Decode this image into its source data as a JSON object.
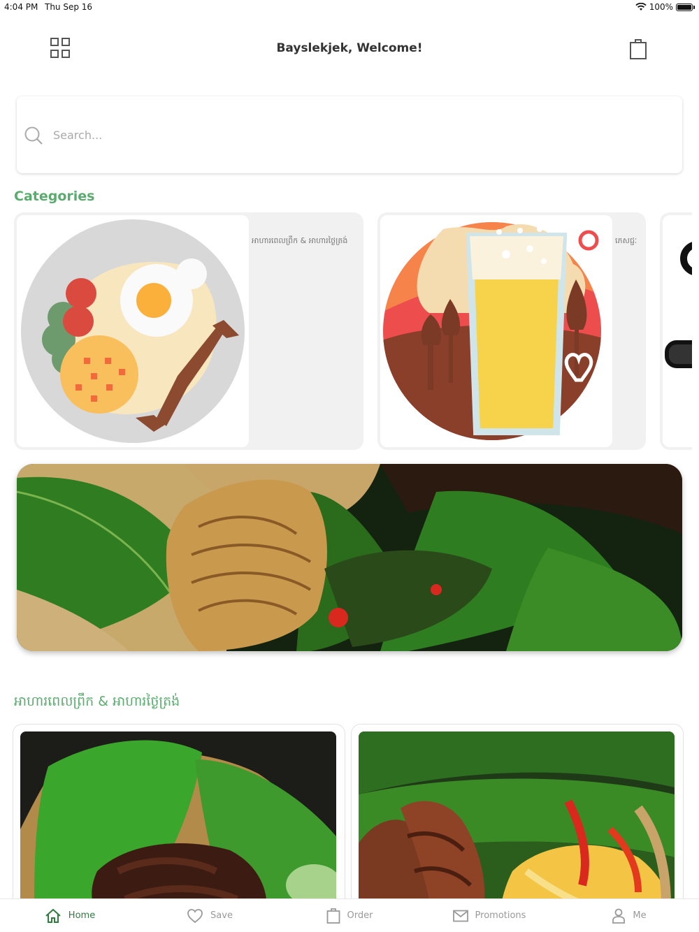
{
  "status_bar": {
    "time": "4:04 PM",
    "date": "Thu Sep 16",
    "battery": "100%"
  },
  "header": {
    "title": "Bayslekjek, Welcome!",
    "menu_icon": "grid-icon",
    "cart_icon": "shopping-bag-icon"
  },
  "search": {
    "placeholder": "Search..."
  },
  "categories": {
    "title": "Categories",
    "items": [
      {
        "label": "អាហារពេលព្រឹក & អាហារថ្ងៃត្រង់",
        "icon": "breakfast-plate-icon"
      },
      {
        "label": "ភេសជ្ជៈ",
        "icon": "beer-glass-icon"
      },
      {
        "label": "",
        "icon": "partial-category-icon"
      }
    ]
  },
  "banner": {
    "image": "grilled-fish-banner"
  },
  "breakfast_section": {
    "title": "អាហារពេលព្រឹក & អាហារថ្ងៃត្រង់",
    "items": [
      {
        "image": "dried-beef-dish"
      },
      {
        "image": "grilled-sausage-dish"
      }
    ]
  },
  "tab_bar": {
    "items": [
      {
        "label": "Home",
        "icon": "home-icon",
        "active": true
      },
      {
        "label": "Save",
        "icon": "heart-icon",
        "active": false
      },
      {
        "label": "Order",
        "icon": "bag-icon",
        "active": false
      },
      {
        "label": "Promotions",
        "icon": "mail-icon",
        "active": false
      },
      {
        "label": "Me",
        "icon": "user-icon",
        "active": false
      }
    ]
  },
  "colors": {
    "accent": "#5aac6e",
    "active_tab": "#2e7d3e"
  }
}
